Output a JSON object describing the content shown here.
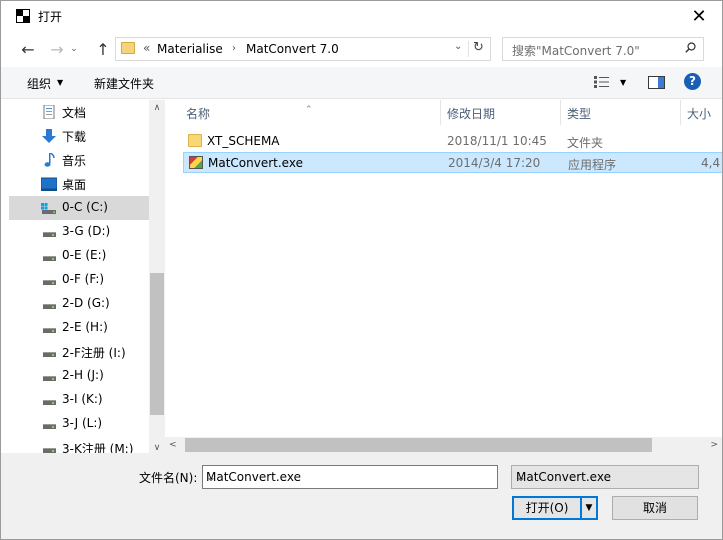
{
  "window": {
    "title": "打开"
  },
  "nav": {
    "breadcrumb_overflow": "«",
    "breadcrumbs": [
      "Materialise",
      "MatConvert 7.0"
    ],
    "separator": "›"
  },
  "search": {
    "placeholder": "搜索\"MatConvert 7.0\""
  },
  "toolbar": {
    "organize_label": "组织",
    "new_folder_label": "新建文件夹"
  },
  "tree": {
    "items": [
      {
        "label": "文档",
        "icon": "document-icon"
      },
      {
        "label": "下载",
        "icon": "download-icon"
      },
      {
        "label": "音乐",
        "icon": "music-icon"
      },
      {
        "label": "桌面",
        "icon": "desktop-icon"
      },
      {
        "label": "0-C (C:)",
        "icon": "system-drive-icon",
        "selected": true
      },
      {
        "label": "3-G (D:)",
        "icon": "drive-icon"
      },
      {
        "label": "0-E (E:)",
        "icon": "drive-icon"
      },
      {
        "label": "0-F (F:)",
        "icon": "drive-icon"
      },
      {
        "label": "2-D (G:)",
        "icon": "drive-icon"
      },
      {
        "label": "2-E (H:)",
        "icon": "drive-icon"
      },
      {
        "label": "2-F注册 (I:)",
        "icon": "drive-icon"
      },
      {
        "label": "2-H (J:)",
        "icon": "drive-icon"
      },
      {
        "label": "3-I (K:)",
        "icon": "drive-icon"
      },
      {
        "label": "3-J (L:)",
        "icon": "drive-icon"
      },
      {
        "label": "3-K注册 (M:)",
        "icon": "drive-icon"
      }
    ]
  },
  "columns": {
    "name": "名称",
    "date": "修改日期",
    "type": "类型",
    "size": "大小"
  },
  "files": [
    {
      "name": "XT_SCHEMA",
      "date": "2018/11/1 10:45",
      "type": "文件夹",
      "size": "",
      "icon": "folder-icon"
    },
    {
      "name": "MatConvert.exe",
      "date": "2014/3/4 17:20",
      "type": "应用程序",
      "size": "4,4",
      "icon": "exe-icon",
      "selected": true
    }
  ],
  "bottom": {
    "filename_label": "文件名(N):",
    "filename_value": "MatConvert.exe",
    "filter_value": "MatConvert.exe",
    "open_label": "打开(O)",
    "cancel_label": "取消"
  },
  "colors": {
    "selection": "#cce8ff",
    "accent": "#0078d7",
    "help": "#1b5fb4"
  }
}
